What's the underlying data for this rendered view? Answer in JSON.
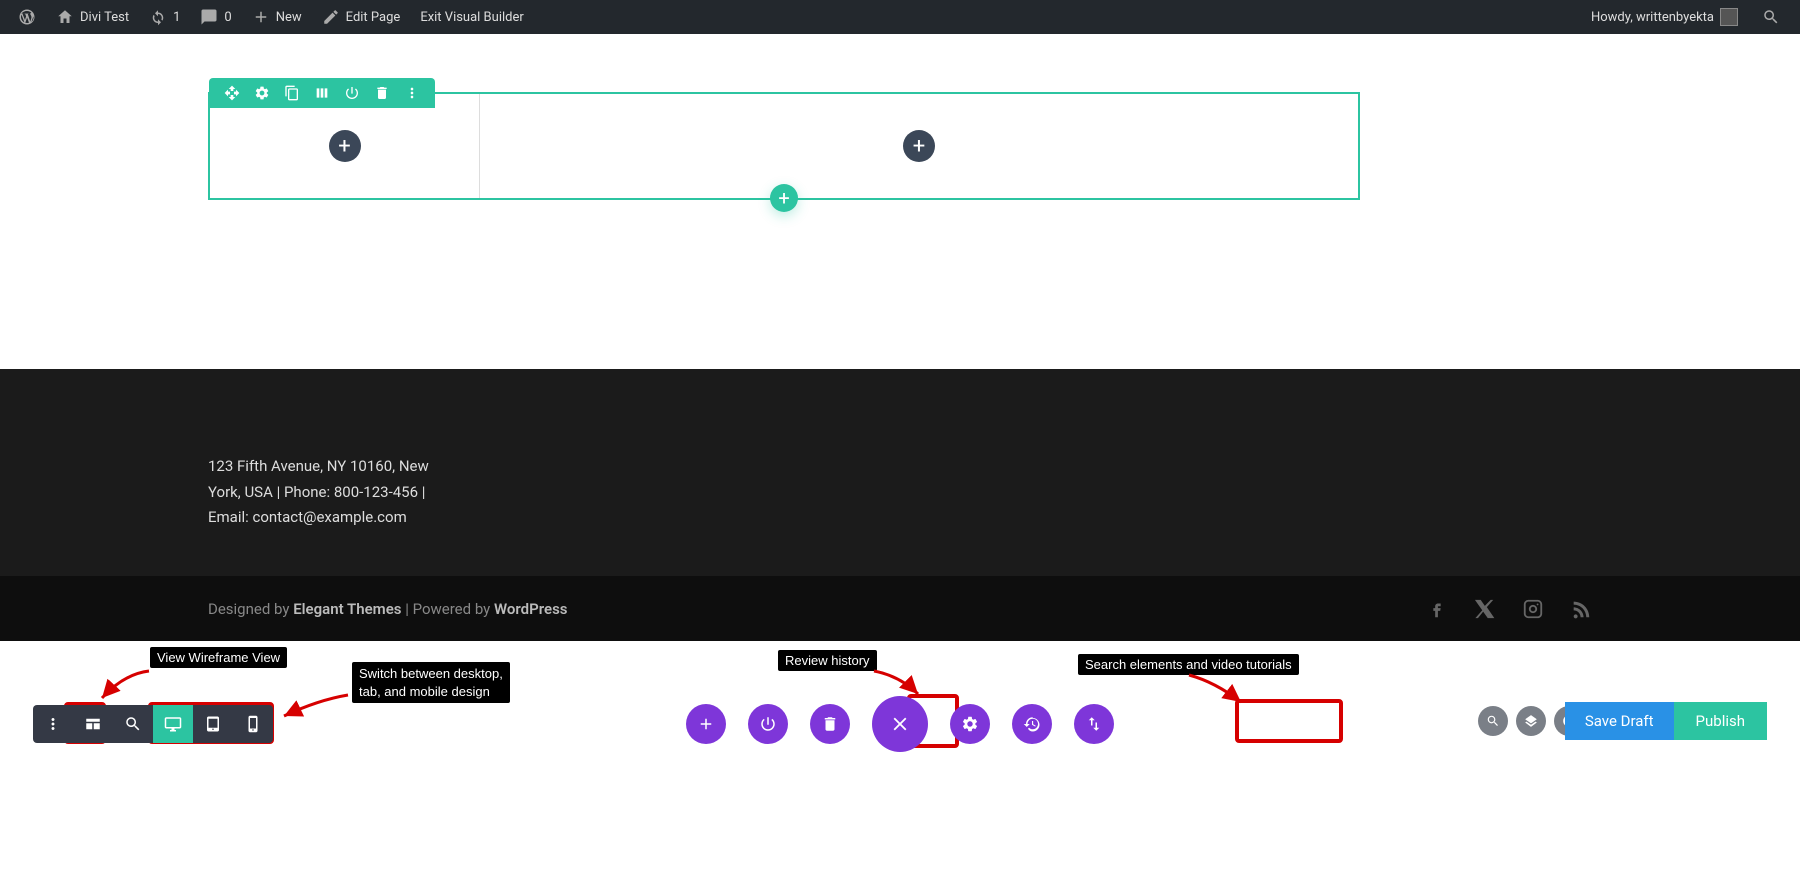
{
  "admin_bar": {
    "site_title": "Divi Test",
    "updates_count": "1",
    "comments_count": "0",
    "new_label": "New",
    "edit_page": "Edit Page",
    "exit_builder": "Exit Visual Builder",
    "howdy": "Howdy, writtenbyekta"
  },
  "footer": {
    "contact_text": "123 Fifth Avenue, NY 10160, New York, USA | Phone: 800-123-456 | Email: contact@example.com",
    "designed_prefix": "Designed by ",
    "designed_by": "Elegant Themes",
    "powered_prefix": " | Powered by ",
    "powered_by": "WordPress"
  },
  "annotations": {
    "wireframe": "View Wireframe View",
    "switch_view_l1": "Switch between desktop,",
    "switch_view_l2": "tab, and mobile design",
    "history": "Review history",
    "search_help": "Search elements and video tutorials"
  },
  "buttons": {
    "save_draft": "Save Draft",
    "publish": "Publish"
  }
}
